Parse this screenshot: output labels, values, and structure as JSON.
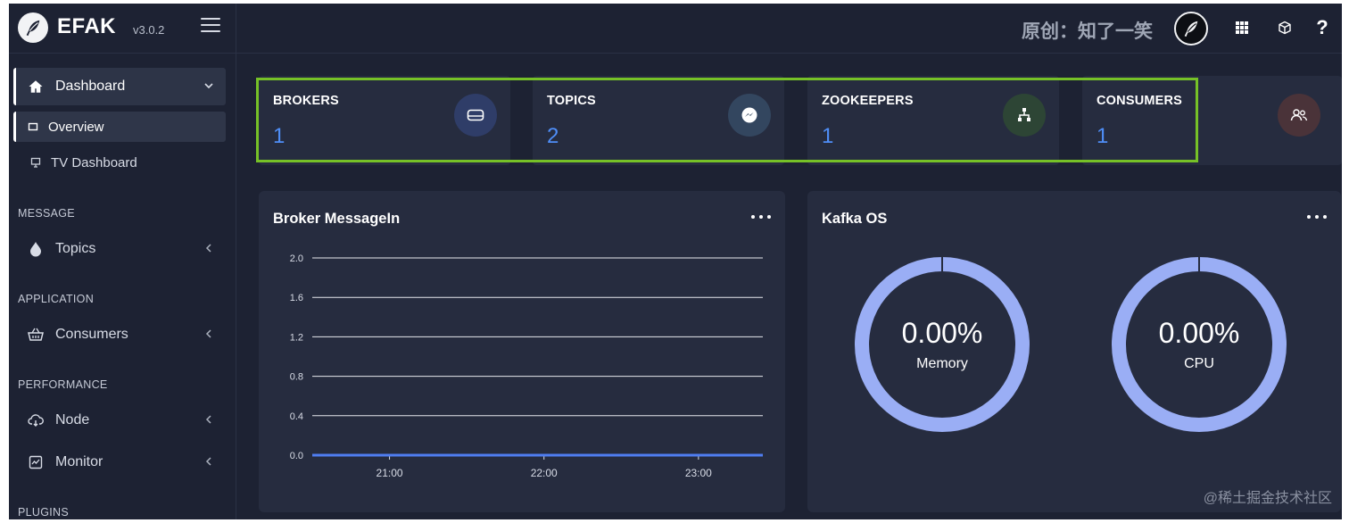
{
  "brand": {
    "name": "EFAK",
    "version": "v3.0.2"
  },
  "header": {
    "author": "原创：知了一笑"
  },
  "sidebar": {
    "dashboard": "Dashboard",
    "overview": "Overview",
    "tv_dashboard": "TV Dashboard",
    "sections": {
      "message": "MESSAGE",
      "application": "APPLICATION",
      "performance": "PERFORMANCE",
      "plugins": "PLUGINS"
    },
    "topics": "Topics",
    "consumers": "Consumers",
    "node": "Node",
    "monitor": "Monitor"
  },
  "stats": [
    {
      "title": "BROKERS",
      "value": "1",
      "icon": "hard-drive-icon",
      "icon_bg": "#2f3d68"
    },
    {
      "title": "TOPICS",
      "value": "2",
      "icon": "messenger-icon",
      "icon_bg": "#33465f"
    },
    {
      "title": "ZOOKEEPERS",
      "value": "1",
      "icon": "sitemap-icon",
      "icon_bg": "#2d4535"
    },
    {
      "title": "CONSUMERS",
      "value": "1",
      "icon": "users-icon",
      "icon_bg": "#4a3339"
    }
  ],
  "broker_panel": {
    "title": "Broker MessageIn"
  },
  "kafka_panel": {
    "title": "Kafka OS",
    "memory": {
      "value": "0.00%",
      "label": "Memory",
      "fraction": 0.0
    },
    "cpu": {
      "value": "0.00%",
      "label": "CPU",
      "fraction": 0.0
    }
  },
  "chart_data": {
    "type": "line",
    "title": "",
    "xlabel": "",
    "ylabel": "",
    "x": [
      "20:30",
      "21:00",
      "21:30",
      "22:00",
      "22:30",
      "23:00",
      "23:25"
    ],
    "x_ticks": [
      "21:00",
      "22:00",
      "23:00"
    ],
    "series": [
      {
        "values": [
          0,
          0,
          0,
          0,
          0,
          0,
          0
        ]
      }
    ],
    "y_ticks": [
      "2.0",
      "1.6",
      "1.2",
      "0.8",
      "0.4",
      "0.0"
    ],
    "ylim": [
      0,
      2.0
    ],
    "grid": true,
    "line_color": "#4f7df0",
    "grid_color": "#e6e8ee"
  },
  "colors": {
    "accent_blue": "#4f8ef7",
    "donut_ring": "#9aaef5",
    "highlight_green": "#76c127"
  },
  "watermark": "@稀土掘金技术社区"
}
